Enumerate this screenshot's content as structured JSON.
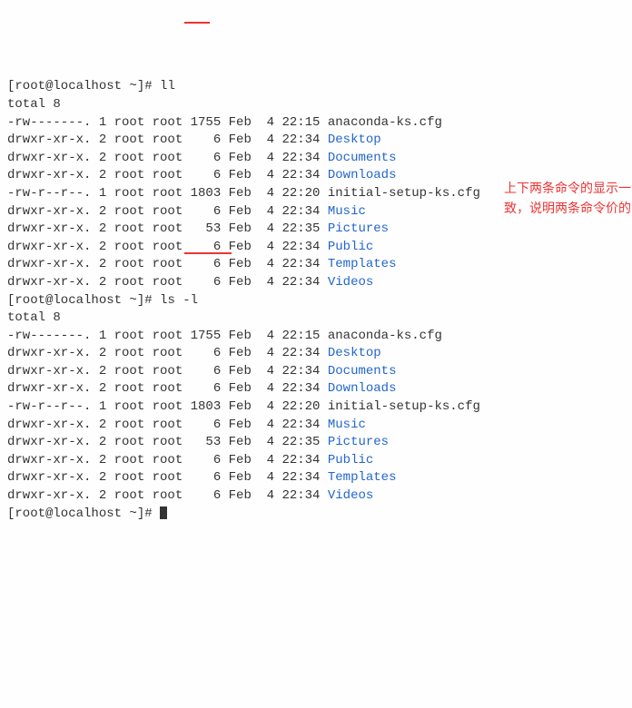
{
  "prompt_prefix": "[root@localhost ~]#",
  "cmd1": "ll",
  "cmd2": "ls -l",
  "total_line": "total 8",
  "listing": [
    {
      "perm": "-rw-------.",
      "links": "1",
      "owner": "root",
      "group": "root",
      "size": "1755",
      "month": "Feb",
      "day": "4",
      "time": "22:15",
      "name": "anaconda-ks.cfg",
      "dir": false
    },
    {
      "perm": "drwxr-xr-x.",
      "links": "2",
      "owner": "root",
      "group": "root",
      "size": "6",
      "month": "Feb",
      "day": "4",
      "time": "22:34",
      "name": "Desktop",
      "dir": true
    },
    {
      "perm": "drwxr-xr-x.",
      "links": "2",
      "owner": "root",
      "group": "root",
      "size": "6",
      "month": "Feb",
      "day": "4",
      "time": "22:34",
      "name": "Documents",
      "dir": true
    },
    {
      "perm": "drwxr-xr-x.",
      "links": "2",
      "owner": "root",
      "group": "root",
      "size": "6",
      "month": "Feb",
      "day": "4",
      "time": "22:34",
      "name": "Downloads",
      "dir": true
    },
    {
      "perm": "-rw-r--r--.",
      "links": "1",
      "owner": "root",
      "group": "root",
      "size": "1803",
      "month": "Feb",
      "day": "4",
      "time": "22:20",
      "name": "initial-setup-ks.cfg",
      "dir": false
    },
    {
      "perm": "drwxr-xr-x.",
      "links": "2",
      "owner": "root",
      "group": "root",
      "size": "6",
      "month": "Feb",
      "day": "4",
      "time": "22:34",
      "name": "Music",
      "dir": true
    },
    {
      "perm": "drwxr-xr-x.",
      "links": "2",
      "owner": "root",
      "group": "root",
      "size": "53",
      "month": "Feb",
      "day": "4",
      "time": "22:35",
      "name": "Pictures",
      "dir": true
    },
    {
      "perm": "drwxr-xr-x.",
      "links": "2",
      "owner": "root",
      "group": "root",
      "size": "6",
      "month": "Feb",
      "day": "4",
      "time": "22:34",
      "name": "Public",
      "dir": true
    },
    {
      "perm": "drwxr-xr-x.",
      "links": "2",
      "owner": "root",
      "group": "root",
      "size": "6",
      "month": "Feb",
      "day": "4",
      "time": "22:34",
      "name": "Templates",
      "dir": true
    },
    {
      "perm": "drwxr-xr-x.",
      "links": "2",
      "owner": "root",
      "group": "root",
      "size": "6",
      "month": "Feb",
      "day": "4",
      "time": "22:34",
      "name": "Videos",
      "dir": true
    }
  ],
  "annotation_lines": {
    "l1": "上下两条命令的显示一致，说明两条命令价的"
  }
}
